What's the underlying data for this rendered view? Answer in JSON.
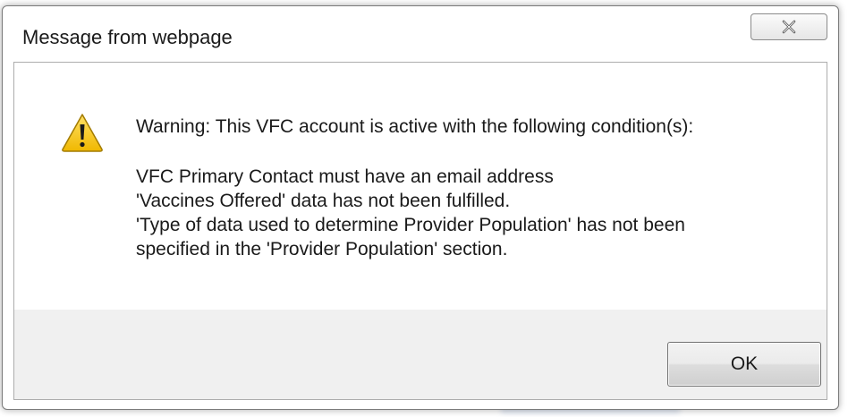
{
  "dialog": {
    "title": "Message from webpage",
    "close_icon": "close-icon",
    "warning_icon": "warning-icon",
    "heading": "Warning: This VFC account is active with the following condition(s):",
    "conditions": [
      "VFC Primary Contact must have an email address",
      "'Vaccines Offered' data has not been fulfilled.",
      "'Type of data used to determine Provider Population' has not been",
      "specified in the 'Provider Population' section."
    ],
    "ok_label": "OK"
  },
  "colors": {
    "footer_background": "#f0f0f0",
    "warning_yellow": "#f5c400",
    "frame_border": "#7a7a7a"
  }
}
